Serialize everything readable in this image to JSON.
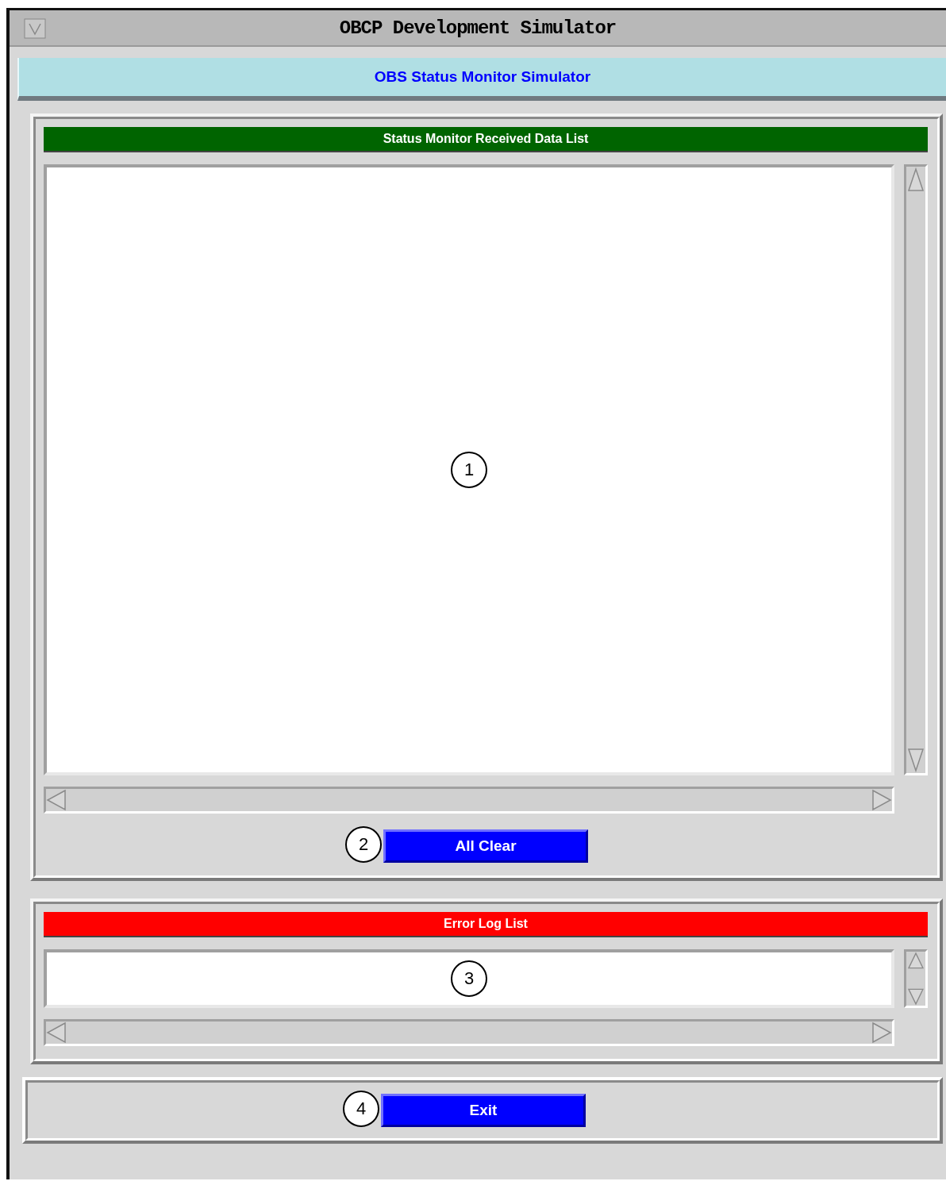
{
  "window": {
    "title": "OBCP Development Simulator"
  },
  "header": {
    "title": "OBS Status Monitor Simulator"
  },
  "panels": [
    {
      "kind": "large_list",
      "title": "Status Monitor Received Data List",
      "color": "#006400",
      "callout": "1",
      "button": {
        "label": "All Clear",
        "callout": "2"
      }
    },
    {
      "kind": "small_list",
      "title": "Error Log List",
      "color": "#ff0000",
      "callout": "3"
    }
  ],
  "exit_button": {
    "label": "Exit",
    "callout": "4"
  }
}
